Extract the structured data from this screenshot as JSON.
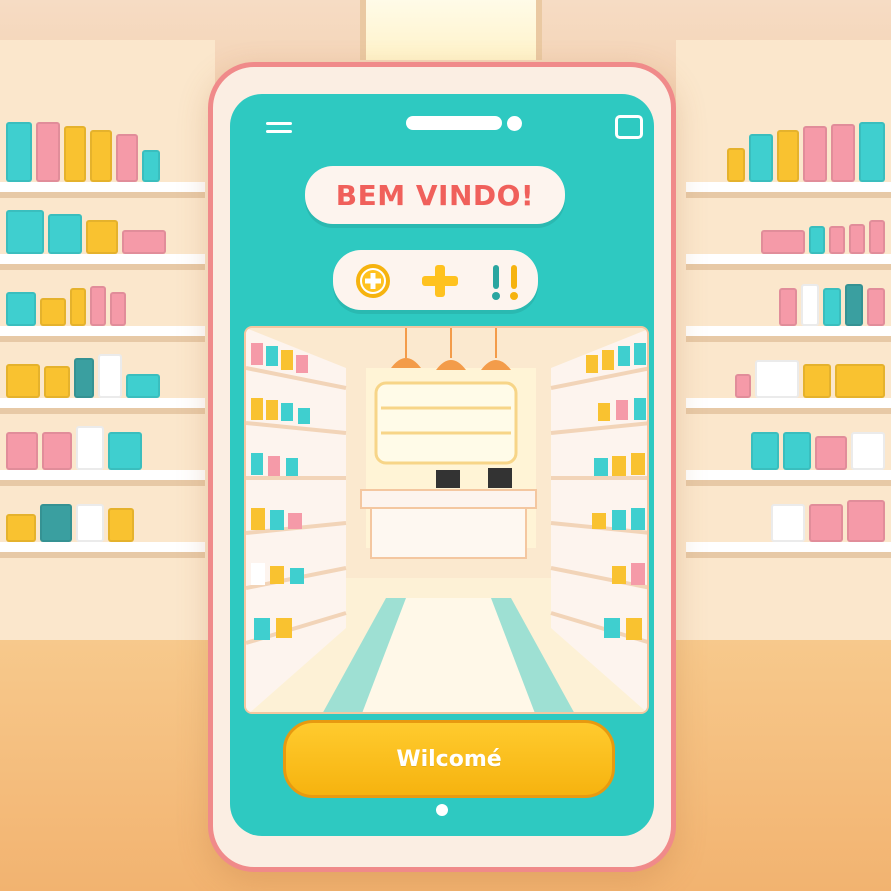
{
  "screen": {
    "title": "BEM VINDO!",
    "button_label": "Wilcomé"
  },
  "icons": {
    "menu": "hamburger-menu-icon",
    "window": "square-window-icon",
    "plus_circle": "plus-circle-icon",
    "plus": "plus-icon",
    "exclamation": "exclamation-icon"
  },
  "colors": {
    "screen_bg": "#2ec9c1",
    "phone_border": "#f08a8a",
    "title_text": "#f0605b",
    "button": "#ffc21f",
    "accent_yellow": "#f6b30f"
  }
}
